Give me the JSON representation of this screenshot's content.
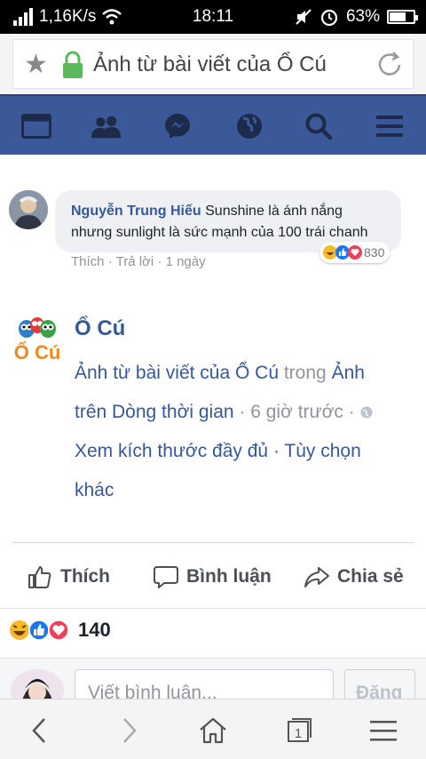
{
  "status_bar": {
    "network_speed": "1,16K/s",
    "time": "18:11",
    "battery_percent": "63%",
    "battery_level": 0.63
  },
  "browser": {
    "url_title": "Ảnh từ bài viết của Ổ Cú"
  },
  "comment": {
    "author": "Nguyễn Trung Hiếu",
    "text": " Sunshine là ánh nắng nhưng sunlight là sức mạnh của 100 trái chanh",
    "reaction_count": "830",
    "like_label": "Thích",
    "reply_label": "Trả lời",
    "time_ago": "1 ngày",
    "sep": "·"
  },
  "post": {
    "page_name": "Ổ Cú",
    "source_link": "Ảnh từ bài viết của Ổ Cú",
    "in_word": " trong ",
    "album_link": "Ảnh trên Dòng thời gian",
    "time_ago": "6 giờ trước",
    "sep": "·",
    "full_size_link": "Xem kích thước đầy đủ",
    "more_options_link": "Tùy chọn khác"
  },
  "actions": {
    "like": "Thích",
    "comment": "Bình luận",
    "share": "Chia sẻ"
  },
  "reactions": {
    "count": "140"
  },
  "composer": {
    "placeholder": "Viết bình luận...",
    "post_label": "Đăng"
  },
  "colors": {
    "fb_blue": "#3b5998",
    "link_blue": "#365899",
    "muted_gray": "#90949c"
  }
}
